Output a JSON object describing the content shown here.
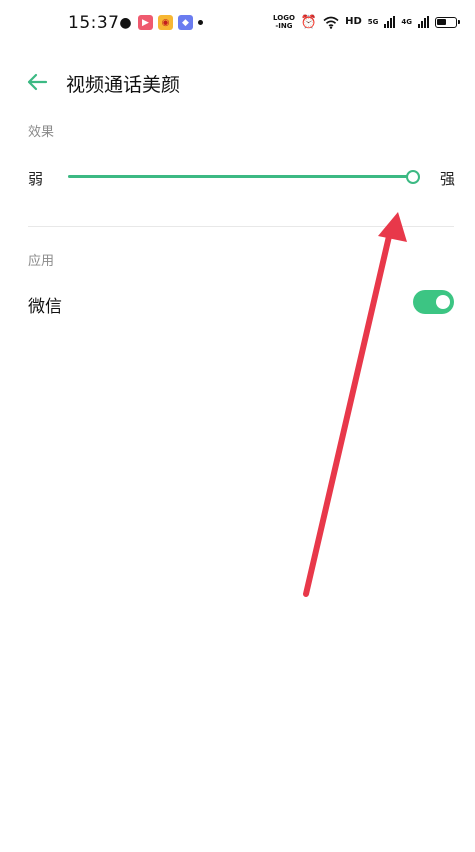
{
  "status_bar": {
    "time": "15:37",
    "notifications": [
      "wechat-icon",
      "video-app-icon",
      "weibo-icon",
      "app-icon"
    ],
    "labels": {
      "hd": "HD",
      "net1": "5G",
      "net2": "4G",
      "logo_top": "LOGO",
      "logo_bottom": "-ING"
    }
  },
  "app_bar": {
    "title": "视频通话美颜",
    "back_icon": "arrow-left-icon"
  },
  "effect_section": {
    "label": "效果",
    "slider": {
      "min_label": "弱",
      "max_label": "强",
      "value": 1.0
    }
  },
  "apps_section": {
    "label": "应用",
    "items": [
      {
        "label": "微信",
        "enabled": true
      }
    ]
  },
  "colors": {
    "accent": "#3cb983",
    "toggle_on": "#3cc583",
    "annotation": "#e8384a"
  }
}
